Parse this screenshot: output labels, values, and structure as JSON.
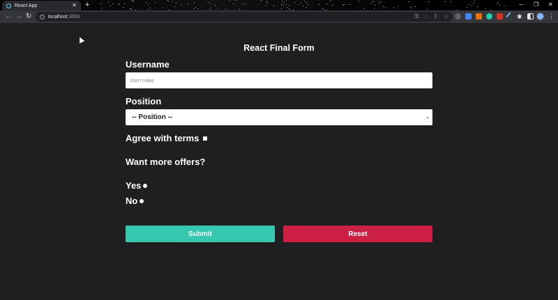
{
  "browser": {
    "tab_title": "React App",
    "tab_close": "✕",
    "new_tab": "+",
    "url_host": "localhost",
    "url_port": ":3000",
    "window_controls": [
      "─",
      "❐",
      "✕"
    ]
  },
  "form": {
    "title": "React Final Form",
    "username_label": "Username",
    "username_placeholder": "Username",
    "username_value": "",
    "position_label": "Position",
    "position_selected": "-- Position --",
    "agree_label": "Agree with terms",
    "offers_label": "Want more offers?",
    "radio_yes": "Yes",
    "radio_no": "No",
    "submit_label": "Submit",
    "reset_label": "Reset"
  },
  "colors": {
    "page_bg": "#1f1f21",
    "submit": "#36c9b0",
    "reset": "#cb1f43"
  },
  "icons": [
    "info-icon",
    "key-icon",
    "eye-off-icon",
    "share-icon",
    "star-icon",
    "puzzle-icon",
    "sidebar-icon",
    "chevron-down-icon"
  ]
}
